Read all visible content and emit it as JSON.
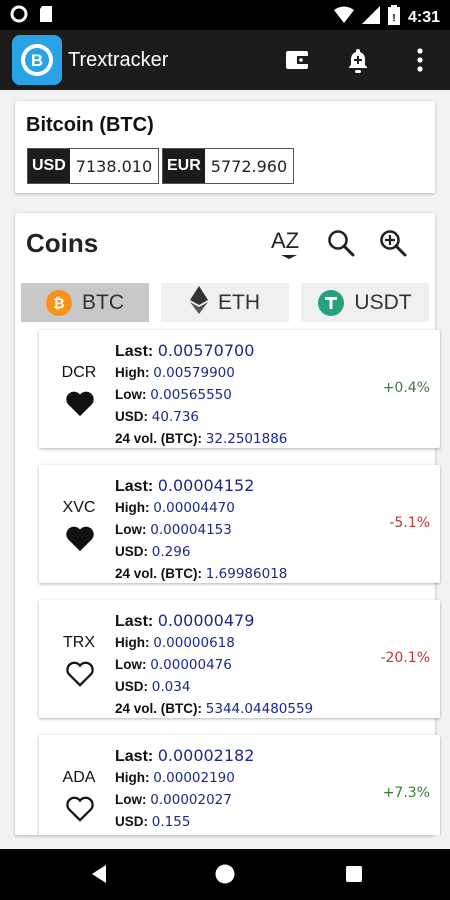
{
  "status": {
    "time": "4:31"
  },
  "app": {
    "title": "Trextracker"
  },
  "currency": {
    "title": "Bitcoin (BTC)",
    "prices": [
      {
        "code": "USD",
        "value": "7138.010"
      },
      {
        "code": "EUR",
        "value": "5772.960"
      }
    ]
  },
  "coins_section": {
    "title": "Coins",
    "sort_label": "AZ",
    "tabs": [
      {
        "label": "BTC",
        "icon": "bitcoin-icon",
        "active": true
      },
      {
        "label": "ETH",
        "icon": "ethereum-icon",
        "active": false
      },
      {
        "label": "USDT",
        "icon": "tether-icon",
        "active": false
      }
    ]
  },
  "labels": {
    "last": "Last:",
    "high": "High:",
    "low": "Low:",
    "usd": "USD:",
    "vol": "24 vol. (BTC):"
  },
  "coins": [
    {
      "symbol": "DCR",
      "last": "0.00570700",
      "high": "0.00579900",
      "low": "0.00565550",
      "usd": "40.736",
      "vol": "32.2501886",
      "change": "+0.4%",
      "favorite": true
    },
    {
      "symbol": "XVC",
      "last": "0.00004152",
      "high": "0.00004470",
      "low": "0.00004153",
      "usd": "0.296",
      "vol": "1.69986018",
      "change": "-5.1%",
      "favorite": true
    },
    {
      "symbol": "TRX",
      "last": "0.00000479",
      "high": "0.00000618",
      "low": "0.00000476",
      "usd": "0.034",
      "vol": "5344.04480559",
      "change": "-20.1%",
      "favorite": false
    },
    {
      "symbol": "ADA",
      "last": "0.00002182",
      "high": "0.00002190",
      "low": "0.00002027",
      "usd": "0.155",
      "vol": "",
      "change": "+7.3%",
      "favorite": false
    }
  ],
  "colors": {
    "positive": "#3a7d3a",
    "negative": "#c0392b",
    "value": "#1a2a8c",
    "appbar": "#1c1c1c",
    "logo": "#29a3e6",
    "bitcoin": "#f7931a",
    "tether": "#26a17b"
  }
}
